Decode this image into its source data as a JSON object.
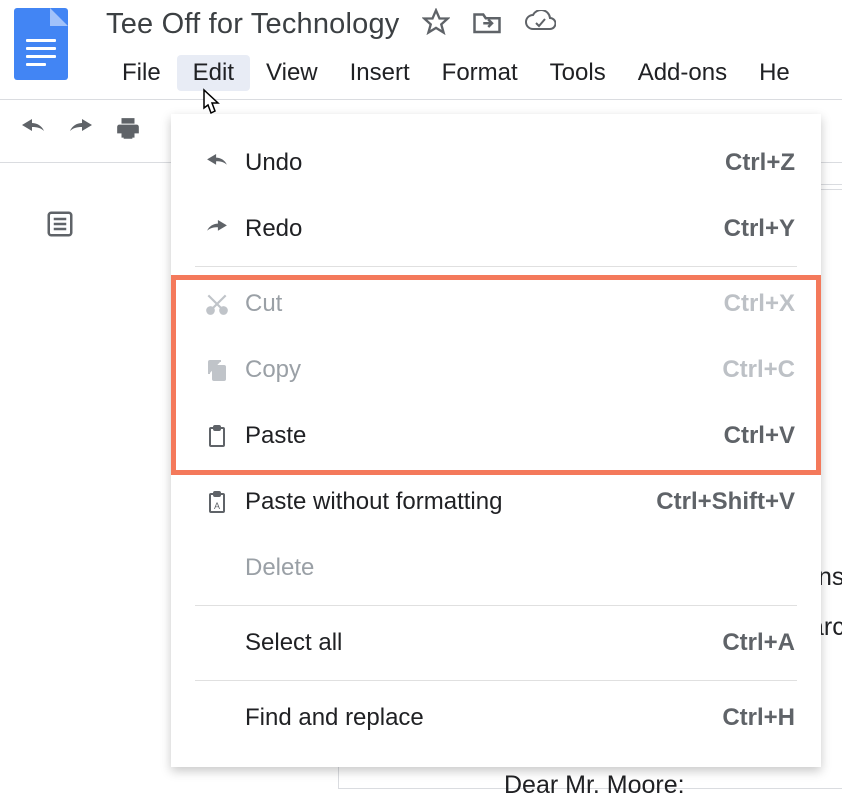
{
  "doc": {
    "title": "Tee Off for Technology",
    "body_fragment1": "ns",
    "body_fragment2": "arc",
    "salutation": "Dear Mr. Moore:"
  },
  "menubar": {
    "items": [
      "File",
      "Edit",
      "View",
      "Insert",
      "Format",
      "Tools",
      "Add-ons",
      "He"
    ],
    "active_index": 1
  },
  "dropdown": {
    "items": [
      {
        "label": "Undo",
        "shortcut": "Ctrl+Z",
        "icon": "undo",
        "disabled": false
      },
      {
        "label": "Redo",
        "shortcut": "Ctrl+Y",
        "icon": "redo",
        "disabled": false
      },
      {
        "sep": true
      },
      {
        "label": "Cut",
        "shortcut": "Ctrl+X",
        "icon": "cut",
        "disabled": true
      },
      {
        "label": "Copy",
        "shortcut": "Ctrl+C",
        "icon": "copy",
        "disabled": true
      },
      {
        "label": "Paste",
        "shortcut": "Ctrl+V",
        "icon": "paste",
        "disabled": false
      },
      {
        "label": "Paste without formatting",
        "shortcut": "Ctrl+Shift+V",
        "icon": "paste-plain",
        "disabled": false
      },
      {
        "label": "Delete",
        "shortcut": "",
        "icon": "",
        "disabled": true
      },
      {
        "sep": true
      },
      {
        "label": "Select all",
        "shortcut": "Ctrl+A",
        "icon": "",
        "disabled": false
      },
      {
        "sep": true
      },
      {
        "label": "Find and replace",
        "shortcut": "Ctrl+H",
        "icon": "",
        "disabled": false
      }
    ]
  }
}
